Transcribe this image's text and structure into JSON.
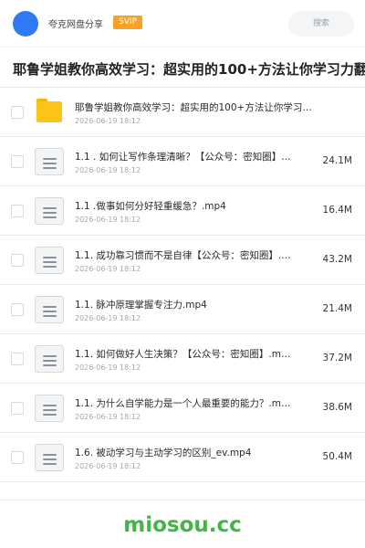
{
  "header": {
    "site_name": "夸克网盘分享",
    "badge": "SVIP",
    "search_label": "搜索"
  },
  "page_title": "耶鲁学姐教你高效学习：超实用的100+方法让你学习力翻10倍",
  "files": [
    {
      "name": "耶鲁学姐教你高效学习：超实用的100+方法让你学习…",
      "date": "2026-06-19 18:12",
      "size": "",
      "type": "folder"
    },
    {
      "name": "1.1 . 如何让写作条理清晰？【公众号：密知圈】…",
      "date": "2026-06-19 18:12",
      "size": "24.1M",
      "type": "file"
    },
    {
      "name": "1.1 .做事如何分好轻重缓急？.mp4",
      "date": "2026-06-19 18:12",
      "size": "16.4M",
      "type": "file"
    },
    {
      "name": "1.1. 成功靠习惯而不是自律【公众号：密知圈】.…",
      "date": "2026-06-19 18:12",
      "size": "43.2M",
      "type": "file"
    },
    {
      "name": "1.1. 脉冲原理掌握专注力.mp4",
      "date": "2026-06-19 18:12",
      "size": "21.4M",
      "type": "file"
    },
    {
      "name": "1.1. 如何做好人生决策？【公众号：密知圈】.m…",
      "date": "2026-06-19 18:12",
      "size": "37.2M",
      "type": "file"
    },
    {
      "name": "1.1. 为什么自学能力是一个人最重要的能力？.m…",
      "date": "2026-06-19 18:12",
      "size": "38.6M",
      "type": "file"
    },
    {
      "name": "1.6. 被动学习与主动学习的区别_ev.mp4",
      "date": "2026-06-19 18:12",
      "size": "50.4M",
      "type": "file"
    }
  ],
  "watermark": "miosou.cc",
  "colors": {
    "avatar": "#2f7bf6",
    "badge": "#f7a126",
    "folder": "#fcc419",
    "watermark": "#43b547"
  }
}
